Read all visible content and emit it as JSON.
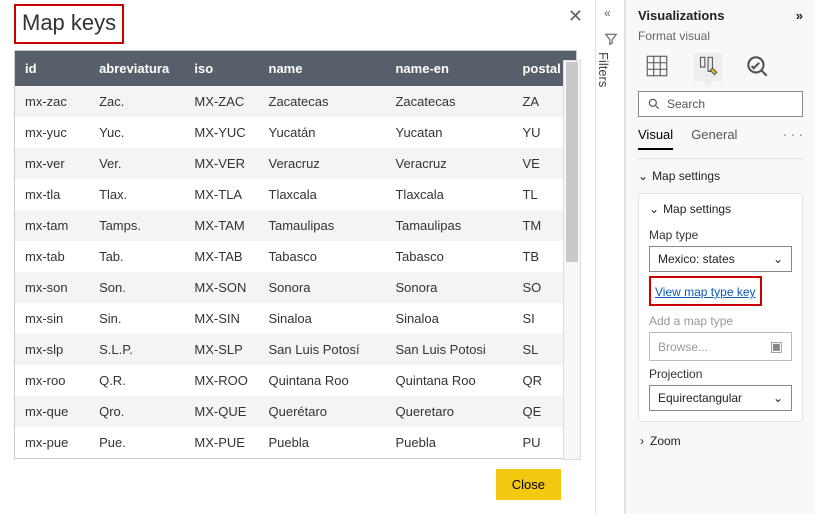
{
  "dialog": {
    "title": "Map keys",
    "close_x": "✕",
    "close_btn": "Close",
    "columns": [
      "id",
      "abreviatura",
      "iso",
      "name",
      "name-en",
      "postal"
    ],
    "rows": [
      {
        "id": "mx-zac",
        "abrev": "Zac.",
        "iso": "MX-ZAC",
        "name": "Zacatecas",
        "name_en": "Zacatecas",
        "postal": "ZA"
      },
      {
        "id": "mx-yuc",
        "abrev": "Yuc.",
        "iso": "MX-YUC",
        "name": "Yucatán",
        "name_en": "Yucatan",
        "postal": "YU"
      },
      {
        "id": "mx-ver",
        "abrev": "Ver.",
        "iso": "MX-VER",
        "name": "Veracruz",
        "name_en": "Veracruz",
        "postal": "VE"
      },
      {
        "id": "mx-tla",
        "abrev": "Tlax.",
        "iso": "MX-TLA",
        "name": "Tlaxcala",
        "name_en": "Tlaxcala",
        "postal": "TL"
      },
      {
        "id": "mx-tam",
        "abrev": "Tamps.",
        "iso": "MX-TAM",
        "name": "Tamaulipas",
        "name_en": "Tamaulipas",
        "postal": "TM"
      },
      {
        "id": "mx-tab",
        "abrev": "Tab.",
        "iso": "MX-TAB",
        "name": "Tabasco",
        "name_en": "Tabasco",
        "postal": "TB"
      },
      {
        "id": "mx-son",
        "abrev": "Son.",
        "iso": "MX-SON",
        "name": "Sonora",
        "name_en": "Sonora",
        "postal": "SO"
      },
      {
        "id": "mx-sin",
        "abrev": "Sin.",
        "iso": "MX-SIN",
        "name": "Sinaloa",
        "name_en": "Sinaloa",
        "postal": "SI"
      },
      {
        "id": "mx-slp",
        "abrev": "S.L.P.",
        "iso": "MX-SLP",
        "name": "San Luis Potosí",
        "name_en": "San Luis Potosi",
        "postal": "SL"
      },
      {
        "id": "mx-roo",
        "abrev": "Q.R.",
        "iso": "MX-ROO",
        "name": "Quintana Roo",
        "name_en": "Quintana Roo",
        "postal": "QR"
      },
      {
        "id": "mx-que",
        "abrev": "Qro.",
        "iso": "MX-QUE",
        "name": "Querétaro",
        "name_en": "Queretaro",
        "postal": "QE"
      },
      {
        "id": "mx-pue",
        "abrev": "Pue.",
        "iso": "MX-PUE",
        "name": "Puebla",
        "name_en": "Puebla",
        "postal": "PU"
      }
    ]
  },
  "rail": {
    "label": "Filters"
  },
  "panel": {
    "title": "Visualizations",
    "subtitle": "Format visual",
    "search_placeholder": "Search",
    "tabs": {
      "visual": "Visual",
      "general": "General"
    },
    "mapsettings_label": "Map settings",
    "card": {
      "header": "Map settings",
      "map_type_label": "Map type",
      "map_type_value": "Mexico: states",
      "view_key_link": "View map type key",
      "add_map_label": "Add a map type",
      "browse_placeholder": "Browse...",
      "projection_label": "Projection",
      "projection_value": "Equirectangular"
    },
    "zoom_label": "Zoom"
  }
}
